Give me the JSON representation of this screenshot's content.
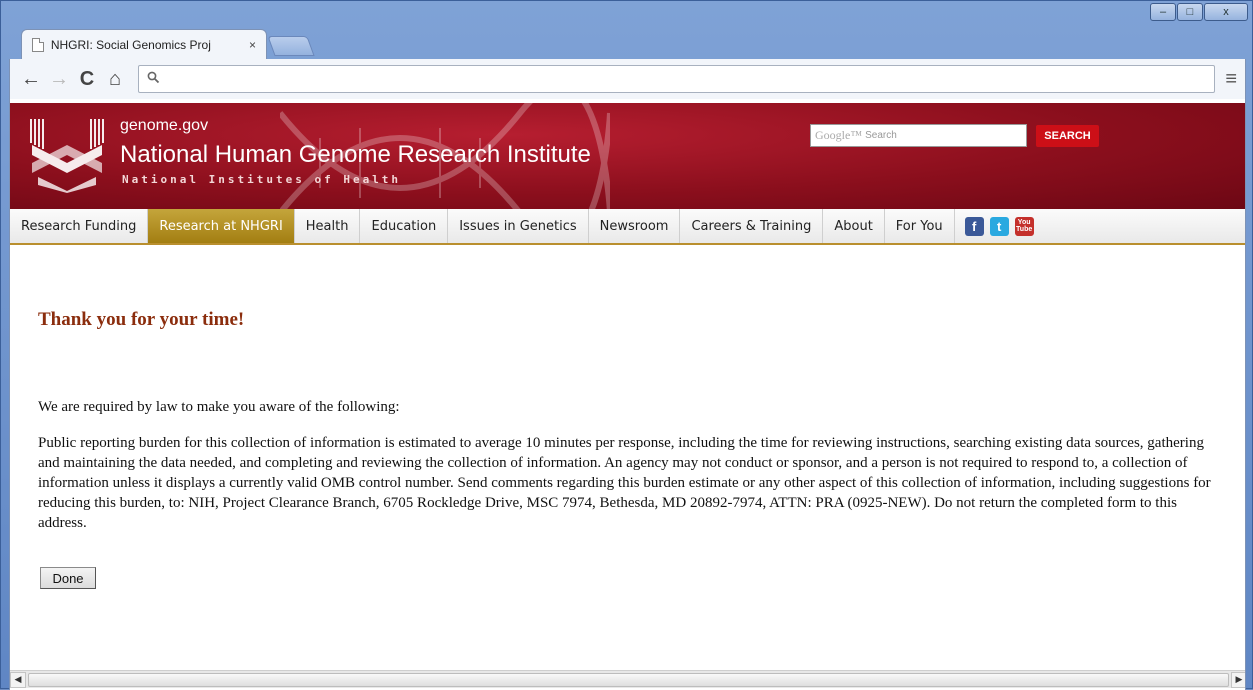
{
  "browser": {
    "tab_title": "NHGRI: Social Genomics Proj",
    "tab_close": "×",
    "window_controls": {
      "minimize": "–",
      "maximize": "□",
      "close": "x"
    },
    "nav": {
      "back": "←",
      "forward": "→",
      "reload": "C",
      "home": "⌂"
    },
    "omnibox_value": "",
    "menu": "≡"
  },
  "header": {
    "site_small": "genome.gov",
    "site_title": "National Human Genome Research Institute",
    "site_sub": "National Institutes of Health",
    "search_placeholder": "Search",
    "search_brand": "Google™",
    "search_button": "SEARCH"
  },
  "navbar": {
    "items": [
      "Research Funding",
      "Research at NHGRI",
      "Health",
      "Education",
      "Issues in Genetics",
      "Newsroom",
      "Careers & Training",
      "About",
      "For You"
    ],
    "active_index": 1,
    "social": {
      "facebook": "f",
      "twitter": "t",
      "youtube_top": "You",
      "youtube_bottom": "Tube"
    }
  },
  "content": {
    "heading": "Thank you for your time!",
    "intro": "We are required by law to make you aware of the following:",
    "body": "Public reporting burden for this collection of information is estimated to average 10 minutes per response, including the time for reviewing instructions, searching existing data sources, gathering and maintaining the data needed, and completing and reviewing the collection of information. An agency may not conduct or sponsor, and a person is not required to respond to, a collection of information unless it displays a currently valid OMB control number. Send comments regarding this burden estimate or any other aspect of this collection of information, including suggestions for reducing this burden, to: NIH, Project Clearance Branch, 6705 Rockledge Drive, MSC 7974, Bethesda, MD 20892-7974, ATTN: PRA (0925-NEW). Do not return the completed form to this address.",
    "done_button": "Done"
  },
  "scrollbar": {
    "left": "◀",
    "right": "▶"
  },
  "colors": {
    "banner": "#8c0f1d",
    "nav_active": "#a37e12",
    "heading": "#8b2d0d",
    "search_button": "#cc0f17"
  }
}
